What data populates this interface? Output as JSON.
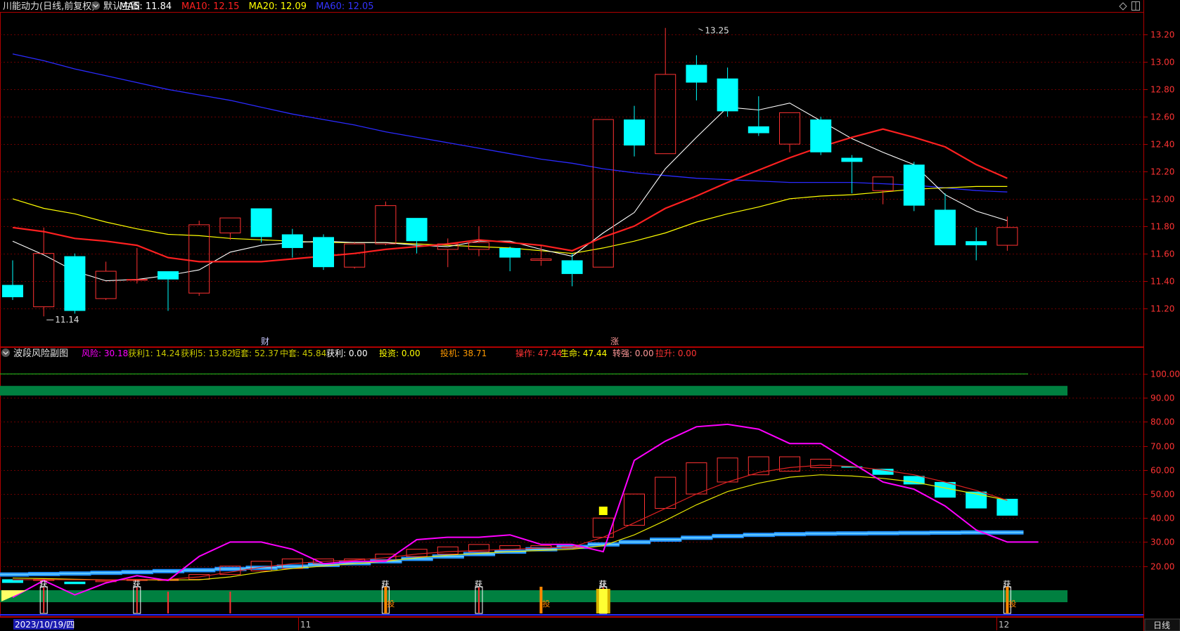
{
  "header": {
    "title": "川能动力(日线,前复权)",
    "template": "默认主图",
    "ma": [
      {
        "label": "MA5: 11.84",
        "color": "#ffffff"
      },
      {
        "label": "MA10: 12.15",
        "color": "#ff2020"
      },
      {
        "label": "MA20: 12.09",
        "color": "#ffff00"
      },
      {
        "label": "MA60: 12.05",
        "color": "#3333ff"
      }
    ]
  },
  "sub": {
    "title": "波段风险副图",
    "items": [
      {
        "label": "风险: 30.18",
        "color": "#ff00ff"
      },
      {
        "label": "获利1: 14.24",
        "color": "#c8c800"
      },
      {
        "label": "获利5: 13.82",
        "color": "#c8c800"
      },
      {
        "label": "短套: 52.37",
        "color": "#c8c800"
      },
      {
        "label": "中套: 45.84",
        "color": "#c8c800"
      },
      {
        "label": "获利: 0.00",
        "color": "#ffffff"
      },
      {
        "label": "投资: 0.00",
        "color": "#ffff00"
      },
      {
        "label": "投机: 38.71",
        "color": "#ff9900"
      },
      {
        "label": "操作: 47.44",
        "color": "#ff3333"
      },
      {
        "label": "生命: 47.44",
        "color": "#ffff00"
      },
      {
        "label": "转强: 0.00",
        "color": "#ff9999"
      },
      {
        "label": "拉升: 0.00",
        "color": "#ff3333"
      }
    ]
  },
  "footer": {
    "date": "2023/10/19/四",
    "month_11": "11",
    "month_12": "12",
    "period": "日线"
  },
  "markers": {
    "cai": "财",
    "zhang": "涨",
    "huo": "获",
    "tou": "投"
  },
  "colors": {
    "up": "#ff3232",
    "down": "#00ffff",
    "ma5": "#ffffff",
    "ma10": "#ff2020",
    "ma20": "#ffff00",
    "ma60": "#2a2aff",
    "grid": "#6a0000",
    "axis": "#b00000"
  },
  "chart_data": {
    "type": "candlestick",
    "main": {
      "ylim": [
        11.1,
        13.3
      ],
      "yticks": [
        "13.20",
        "13.00",
        "12.80",
        "12.60",
        "12.40",
        "12.20",
        "12.00",
        "11.80",
        "11.60",
        "11.40",
        "11.20"
      ],
      "annotations": [
        {
          "text": "13.25",
          "price": 13.25,
          "index": 22
        },
        {
          "text": "11.14",
          "price": 11.14,
          "index": 1
        }
      ],
      "candles": [
        {
          "o": 11.37,
          "c": 11.28,
          "h": 11.55,
          "l": 11.26
        },
        {
          "o": 11.21,
          "c": 11.6,
          "h": 11.79,
          "l": 11.14
        },
        {
          "o": 11.58,
          "c": 11.18,
          "h": 11.6,
          "l": 11.16
        },
        {
          "o": 11.27,
          "c": 11.47,
          "h": 11.54,
          "l": 11.26
        },
        {
          "o": 11.41,
          "c": 11.41,
          "h": 11.64,
          "l": 11.38
        },
        {
          "o": 11.47,
          "c": 11.41,
          "h": 11.47,
          "l": 11.18
        },
        {
          "o": 11.31,
          "c": 11.81,
          "h": 11.84,
          "l": 11.29
        },
        {
          "o": 11.75,
          "c": 11.86,
          "h": 11.86,
          "l": 11.7
        },
        {
          "o": 11.93,
          "c": 11.72,
          "h": 11.93,
          "l": 11.68
        },
        {
          "o": 11.74,
          "c": 11.64,
          "h": 11.78,
          "l": 11.57
        },
        {
          "o": 11.72,
          "c": 11.5,
          "h": 11.74,
          "l": 11.48
        },
        {
          "o": 11.5,
          "c": 11.67,
          "h": 11.68,
          "l": 11.49
        },
        {
          "o": 11.67,
          "c": 11.95,
          "h": 11.98,
          "l": 11.66
        },
        {
          "o": 11.86,
          "c": 11.69,
          "h": 11.86,
          "l": 11.6
        },
        {
          "o": 11.63,
          "c": 11.67,
          "h": 11.71,
          "l": 11.5
        },
        {
          "o": 11.63,
          "c": 11.68,
          "h": 11.8,
          "l": 11.58
        },
        {
          "o": 11.64,
          "c": 11.57,
          "h": 11.65,
          "l": 11.47
        },
        {
          "o": 11.55,
          "c": 11.56,
          "h": 11.66,
          "l": 11.51
        },
        {
          "o": 11.55,
          "c": 11.45,
          "h": 11.6,
          "l": 11.36
        },
        {
          "o": 11.5,
          "c": 12.58,
          "h": 12.58,
          "l": 11.5
        },
        {
          "o": 12.58,
          "c": 12.39,
          "h": 12.68,
          "l": 12.31
        },
        {
          "o": 12.33,
          "c": 12.91,
          "h": 13.25,
          "l": 12.33
        },
        {
          "o": 12.98,
          "c": 12.85,
          "h": 13.05,
          "l": 12.72
        },
        {
          "o": 12.88,
          "c": 12.64,
          "h": 12.96,
          "l": 12.6
        },
        {
          "o": 12.53,
          "c": 12.48,
          "h": 12.75,
          "l": 12.46
        },
        {
          "o": 12.4,
          "c": 12.63,
          "h": 12.63,
          "l": 12.34
        },
        {
          "o": 12.58,
          "c": 12.34,
          "h": 12.6,
          "l": 12.32
        },
        {
          "o": 12.3,
          "c": 12.27,
          "h": 12.32,
          "l": 12.04
        },
        {
          "o": 12.06,
          "c": 12.16,
          "h": 12.16,
          "l": 11.96
        },
        {
          "o": 12.25,
          "c": 11.95,
          "h": 12.27,
          "l": 11.91
        },
        {
          "o": 11.92,
          "c": 11.66,
          "h": 12.04,
          "l": 11.66
        },
        {
          "o": 11.69,
          "c": 11.66,
          "h": 11.79,
          "l": 11.55
        },
        {
          "o": 11.66,
          "c": 11.79,
          "h": 11.87,
          "l": 11.62
        }
      ],
      "ma5": [
        11.69,
        11.59,
        11.47,
        11.4,
        11.41,
        11.44,
        11.48,
        11.61,
        11.66,
        11.68,
        11.69,
        11.68,
        11.68,
        11.66,
        11.65,
        11.69,
        11.69,
        11.63,
        11.58,
        11.75,
        11.9,
        12.22,
        12.45,
        12.67,
        12.65,
        12.7,
        12.57,
        12.44,
        12.34,
        12.25,
        12.03,
        11.91,
        11.84
      ],
      "ma10": [
        11.79,
        11.76,
        11.71,
        11.69,
        11.66,
        11.57,
        11.54,
        11.54,
        11.54,
        11.56,
        11.58,
        11.6,
        11.63,
        11.65,
        11.67,
        11.7,
        11.68,
        11.66,
        11.62,
        11.72,
        11.8,
        11.93,
        12.02,
        12.12,
        12.21,
        12.3,
        12.38,
        12.45,
        12.51,
        12.45,
        12.38,
        12.25,
        12.15
      ],
      "ma20": [
        12.0,
        11.93,
        11.89,
        11.83,
        11.78,
        11.74,
        11.73,
        11.71,
        11.7,
        11.69,
        11.68,
        11.68,
        11.68,
        11.67,
        11.66,
        11.65,
        11.64,
        11.62,
        11.6,
        11.64,
        11.69,
        11.75,
        11.83,
        11.89,
        11.94,
        12.0,
        12.02,
        12.03,
        12.05,
        12.07,
        12.08,
        12.09,
        12.09
      ],
      "ma60": [
        13.06,
        13.01,
        12.95,
        12.9,
        12.85,
        12.8,
        12.76,
        12.72,
        12.67,
        12.62,
        12.58,
        12.54,
        12.49,
        12.45,
        12.41,
        12.37,
        12.33,
        12.29,
        12.26,
        12.22,
        12.19,
        12.17,
        12.15,
        12.14,
        12.13,
        12.12,
        12.12,
        12.12,
        12.11,
        12.1,
        12.08,
        12.06,
        12.05
      ]
    },
    "sub": {
      "ylim": [
        0,
        105
      ],
      "yticks": [
        "100.00",
        "90.00",
        "80.00",
        "70.00",
        "60.00",
        "50.00",
        "40.00",
        "30.00",
        "20.00"
      ],
      "risk": [
        7,
        14,
        8,
        13,
        16,
        14,
        24,
        30,
        30,
        27,
        21,
        22,
        22,
        31,
        32,
        32,
        33,
        29,
        29,
        26,
        64,
        72,
        78,
        79,
        77,
        71,
        71,
        63,
        55,
        52,
        45,
        35,
        30,
        30
      ],
      "candles": [
        {
          "o": 14.5,
          "c": 13.0
        },
        {
          "o": 14.0,
          "c": 14.5
        },
        {
          "o": 13.5,
          "c": 12.5
        },
        {
          "o": 13.5,
          "c": 14.0
        },
        {
          "o": 14.0,
          "c": 14.5
        },
        {
          "o": 14.0,
          "c": 14.5
        },
        {
          "o": 14.5,
          "c": 16.5
        },
        {
          "o": 16.5,
          "c": 20.0
        },
        {
          "o": 18.0,
          "c": 22.0
        },
        {
          "o": 19.0,
          "c": 23.0
        },
        {
          "o": 21.0,
          "c": 23.0
        },
        {
          "o": 22.0,
          "c": 23.0
        },
        {
          "o": 22.5,
          "c": 25.0
        },
        {
          "o": 24.0,
          "c": 27.0
        },
        {
          "o": 25.0,
          "c": 28.0
        },
        {
          "o": 26.0,
          "c": 29.0
        },
        {
          "o": 27.0,
          "c": 28.5
        },
        {
          "o": 27.5,
          "c": 28.5
        },
        {
          "o": 27.5,
          "c": 28.0
        },
        {
          "o": 32.0,
          "c": 40.0
        },
        {
          "o": 37.0,
          "c": 50.0
        },
        {
          "o": 44.0,
          "c": 57.0
        },
        {
          "o": 50.0,
          "c": 63.0
        },
        {
          "o": 55.0,
          "c": 65.0
        },
        {
          "o": 58.0,
          "c": 65.5
        },
        {
          "o": 59.5,
          "c": 65.5
        },
        {
          "o": 61.0,
          "c": 64.5
        },
        {
          "o": 61.5,
          "c": 61.0
        },
        {
          "o": 60.5,
          "c": 58.0
        },
        {
          "o": 57.5,
          "c": 54.0
        },
        {
          "o": 55.0,
          "c": 48.5
        },
        {
          "o": 51.0,
          "c": 44.0
        },
        {
          "o": 48.0,
          "c": 41.0
        }
      ],
      "ma_red": [
        14.3,
        14.4,
        14.3,
        14.3,
        14.3,
        14.5,
        15.5,
        17.5,
        19.5,
        21.0,
        22.0,
        22.5,
        23.5,
        25.0,
        26.0,
        26.5,
        27.0,
        27.5,
        28.0,
        32.0,
        38.0,
        44.0,
        50.0,
        55.0,
        59.0,
        61.0,
        62.0,
        61.5,
        60.0,
        58.0,
        55.0,
        51.5,
        47.4
      ],
      "ma_yellow": [
        15.0,
        14.8,
        14.5,
        14.3,
        14.2,
        14.2,
        14.3,
        15.5,
        17.5,
        19.0,
        20.0,
        21.0,
        22.0,
        23.5,
        24.5,
        25.3,
        26.0,
        26.5,
        27.0,
        28.5,
        33.0,
        39.0,
        45.5,
        51.0,
        54.5,
        57.0,
        58.0,
        57.5,
        56.5,
        55.0,
        52.5,
        50.0,
        47.4
      ],
      "blue_band": [
        16.5,
        16.7,
        16.9,
        17.2,
        17.5,
        17.9,
        18.3,
        18.8,
        19.3,
        19.8,
        20.5,
        21.2,
        22.0,
        23.0,
        24.0,
        25.0,
        26.0,
        27.0,
        28.0,
        29.0,
        30.0,
        31.0,
        31.8,
        32.5,
        33.0,
        33.3,
        33.5,
        33.6,
        33.7,
        33.8,
        33.9,
        34.0,
        34.0
      ],
      "green_band": [
        91,
        95
      ],
      "huo_bars": [
        1,
        4,
        12,
        15,
        19,
        32
      ],
      "tou_bars": [
        12,
        17,
        32
      ],
      "small_red_bars": [
        5,
        7
      ]
    }
  }
}
